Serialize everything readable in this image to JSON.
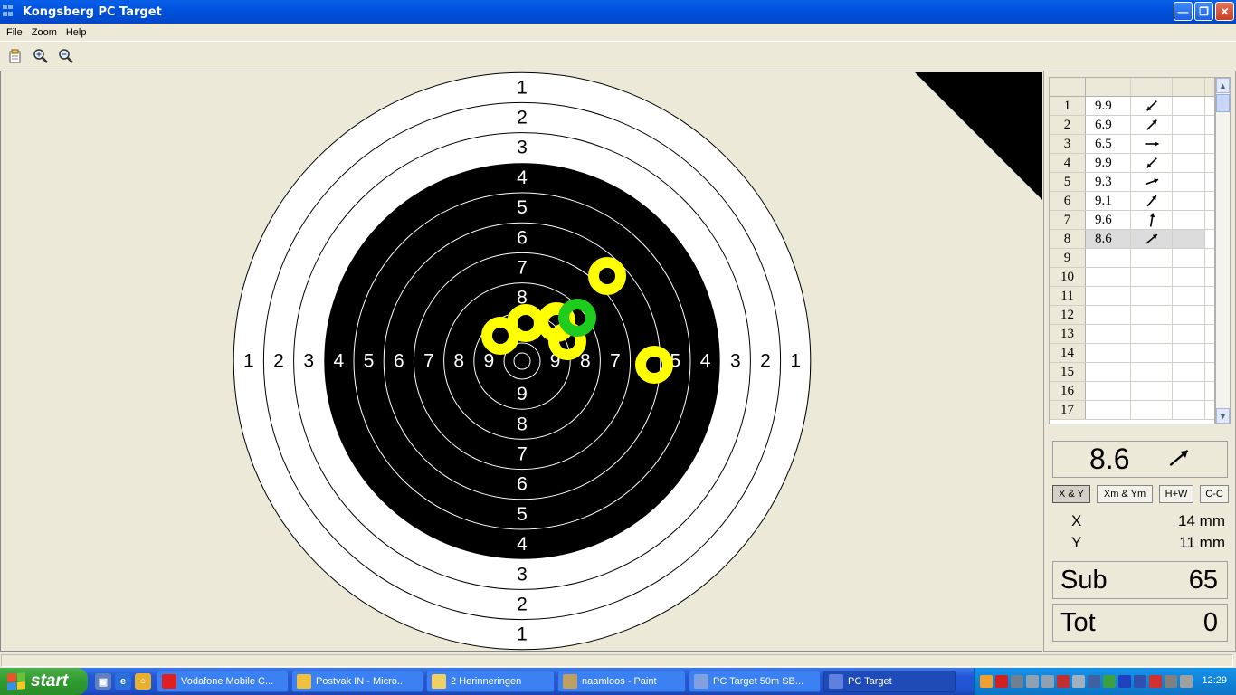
{
  "window": {
    "title": "Kongsberg PC Target"
  },
  "menu": [
    "File",
    "Zoom",
    "Help"
  ],
  "toolbar": {
    "icons": [
      "new-icon",
      "zoom-in-icon",
      "zoom-out-icon"
    ]
  },
  "target": {
    "top_labels": [
      "1",
      "2",
      "3",
      "4",
      "5",
      "6",
      "7",
      "8"
    ],
    "bottom_labels": [
      "9",
      "8",
      "7",
      "6",
      "5",
      "4",
      "3",
      "2",
      "1"
    ],
    "left_labels": [
      "1",
      "2",
      "3",
      "4",
      "5",
      "6",
      "7",
      "8",
      "9"
    ],
    "right_labels": [
      "9",
      "8",
      "7",
      "5",
      "4",
      "3",
      "2",
      "1"
    ],
    "colors": {
      "shot": "#FFFF00",
      "last_shot": "#1DCC1D",
      "black": "#000000"
    }
  },
  "shot_table": {
    "rows": [
      {
        "n": "1",
        "score": "9.9",
        "dir": 225
      },
      {
        "n": "2",
        "score": "6.9",
        "dir": 45
      },
      {
        "n": "3",
        "score": "6.5",
        "dir": 0
      },
      {
        "n": "4",
        "score": "9.9",
        "dir": 225
      },
      {
        "n": "5",
        "score": "9.3",
        "dir": 20
      },
      {
        "n": "6",
        "score": "9.1",
        "dir": 50
      },
      {
        "n": "7",
        "score": "9.6",
        "dir": 80
      },
      {
        "n": "8",
        "score": "8.6",
        "dir": 40
      },
      {
        "n": "9",
        "score": "",
        "dir": null
      },
      {
        "n": "10",
        "score": "",
        "dir": null
      },
      {
        "n": "11",
        "score": "",
        "dir": null
      },
      {
        "n": "12",
        "score": "",
        "dir": null
      },
      {
        "n": "13",
        "score": "",
        "dir": null
      },
      {
        "n": "14",
        "score": "",
        "dir": null
      },
      {
        "n": "15",
        "score": "",
        "dir": null
      },
      {
        "n": "16",
        "score": "",
        "dir": null
      },
      {
        "n": "17",
        "score": "",
        "dir": null
      }
    ],
    "selected": 7
  },
  "last_shot": {
    "score": "8.6",
    "dir": 40
  },
  "modes": [
    "X & Y",
    "Xm & Ym",
    "H+W",
    "C-C"
  ],
  "coords": {
    "x_label": "X",
    "x_value": "14 mm",
    "y_label": "Y",
    "y_value": "11 mm"
  },
  "summary": {
    "sub_label": "Sub",
    "sub_value": "65",
    "tot_label": "Tot",
    "tot_value": "0"
  },
  "taskbar": {
    "start": "start",
    "tasks": [
      {
        "label": "Vodafone Mobile C...",
        "color": "#E02020"
      },
      {
        "label": "Postvak IN - Micro...",
        "color": "#F0C040"
      },
      {
        "label": "2 Herinneringen",
        "color": "#F0D060"
      },
      {
        "label": "naamloos - Paint",
        "color": "#C0A060"
      },
      {
        "label": "PC Target 50m SB...",
        "color": "#80A0E0"
      },
      {
        "label": "PC Target",
        "color": "#6080E0"
      }
    ],
    "clock": "12:29"
  }
}
